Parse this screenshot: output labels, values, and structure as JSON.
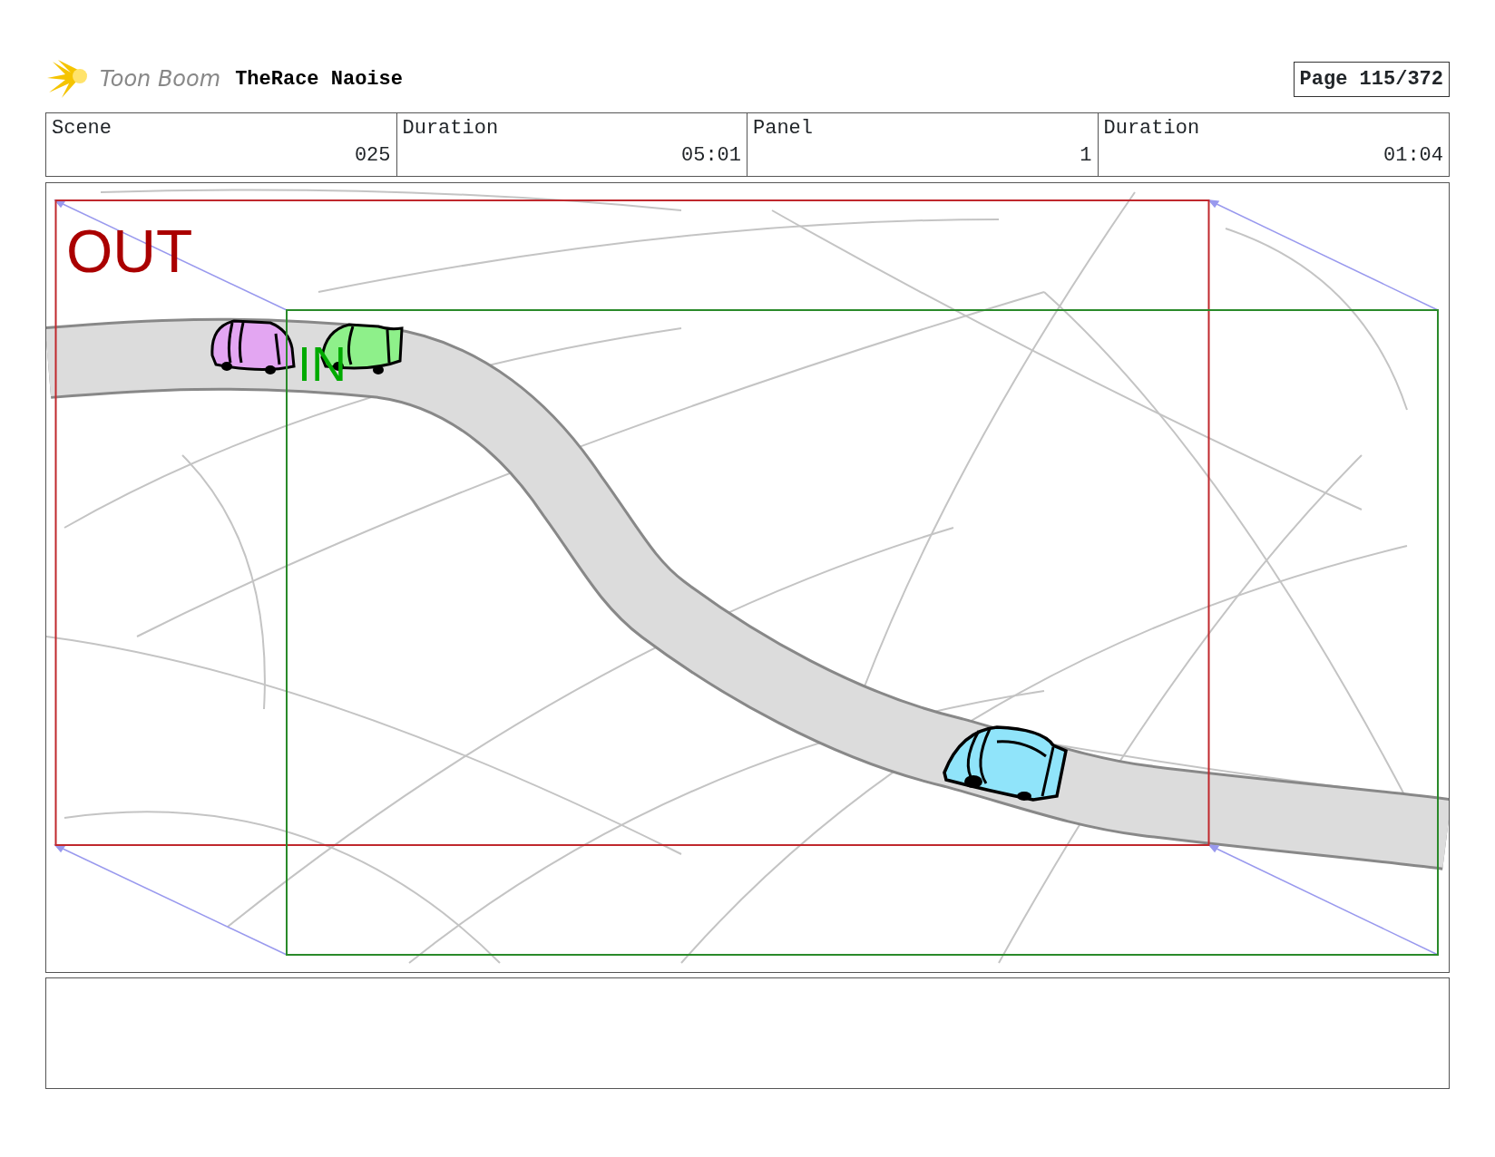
{
  "header": {
    "logo_text": "Toon Boom",
    "project": "TheRace Naoise",
    "page": "Page 115/372"
  },
  "info_table": {
    "columns": [
      "Scene",
      "Duration",
      "Panel",
      "Duration"
    ],
    "values": [
      "025",
      "05:01",
      "1",
      "01:04"
    ]
  },
  "panel": {
    "out_label": "OUT",
    "in_label": "IN"
  }
}
